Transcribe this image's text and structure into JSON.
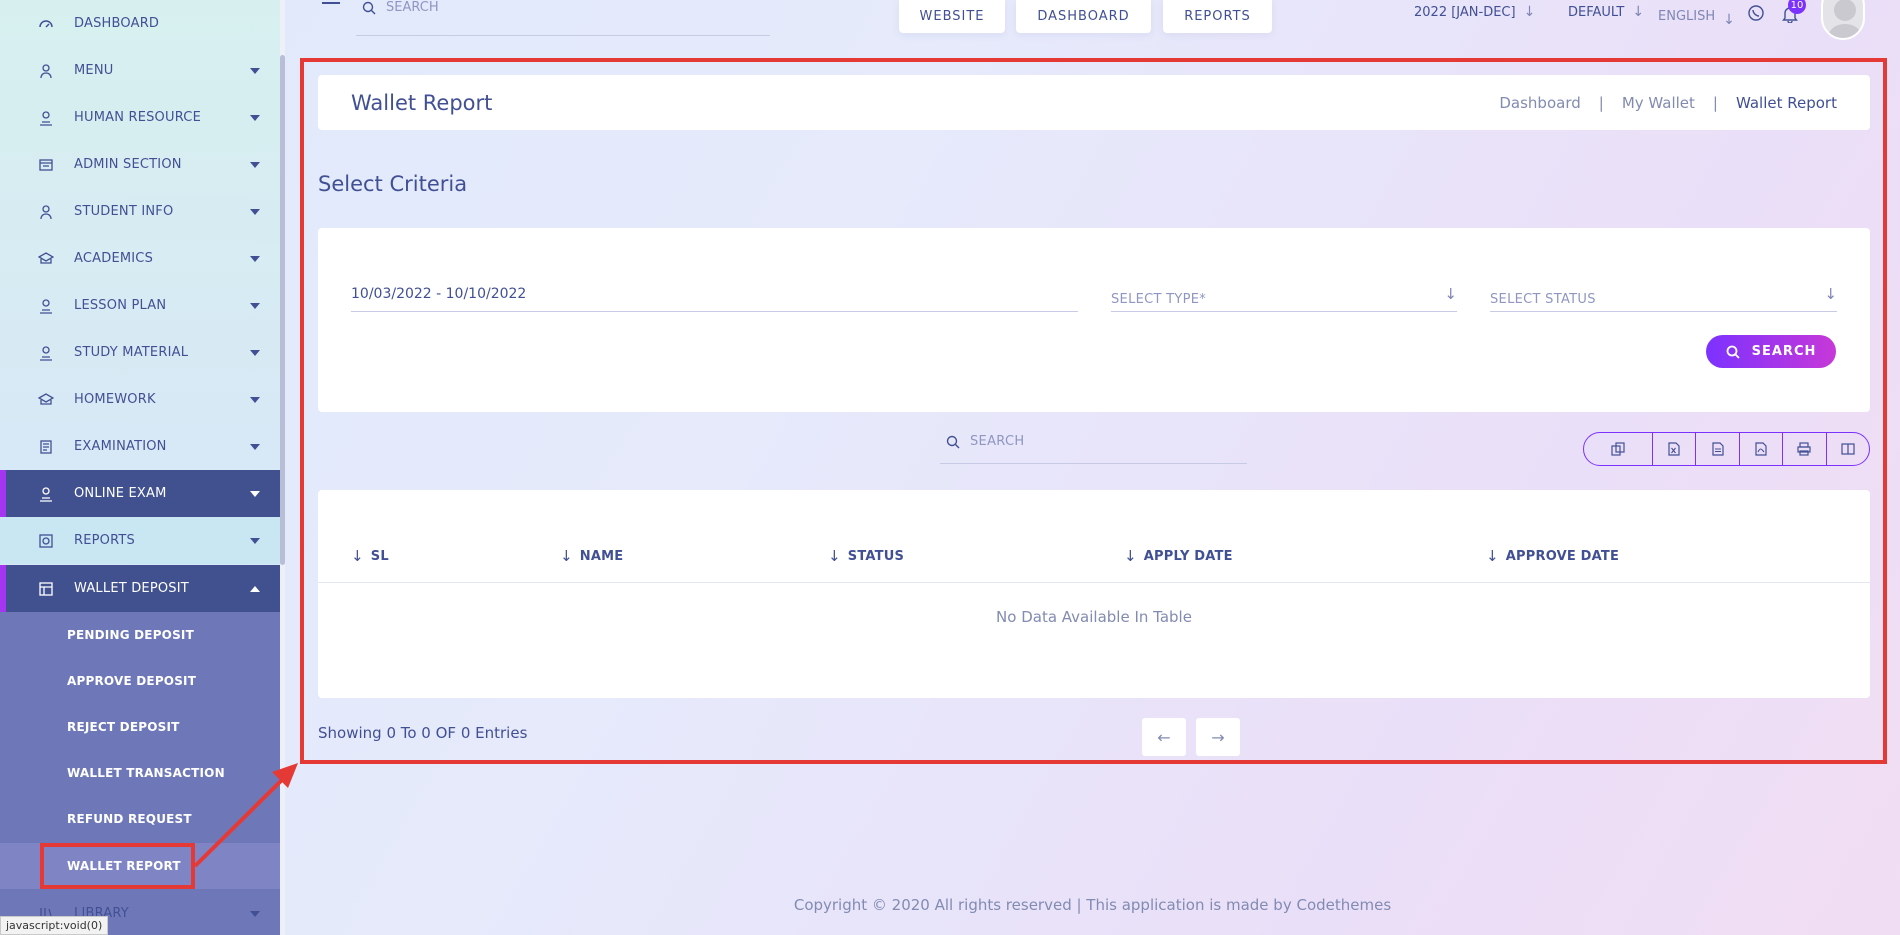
{
  "sidebar": {
    "items": [
      {
        "label": "DASHBOARD",
        "icon": "dashboard-icon"
      },
      {
        "label": "MENU",
        "icon": "menu-icon"
      },
      {
        "label": "HUMAN RESOURCE",
        "icon": "human-resource-icon"
      },
      {
        "label": "ADMIN SECTION",
        "icon": "admin-icon"
      },
      {
        "label": "STUDENT INFO",
        "icon": "student-icon"
      },
      {
        "label": "ACADEMICS",
        "icon": "academics-icon"
      },
      {
        "label": "LESSON PLAN",
        "icon": "lesson-icon"
      },
      {
        "label": "STUDY MATERIAL",
        "icon": "study-icon"
      },
      {
        "label": "HOMEWORK",
        "icon": "homework-icon"
      },
      {
        "label": "EXAMINATION",
        "icon": "examination-icon"
      },
      {
        "label": "ONLINE EXAM",
        "icon": "online-exam-icon"
      },
      {
        "label": "REPORTS",
        "icon": "reports-icon"
      },
      {
        "label": "WALLET DEPOSIT",
        "icon": "wallet-icon"
      },
      {
        "label": "LIBRARY",
        "icon": "library-icon"
      }
    ],
    "wallet_submenu": [
      "PENDING DEPOSIT",
      "APPROVE DEPOSIT",
      "REJECT DEPOSIT",
      "WALLET TRANSACTION",
      "REFUND REQUEST",
      "WALLET REPORT"
    ],
    "status_tip": "javascript:void(0)"
  },
  "topbar": {
    "search_placeholder": "SEARCH",
    "buttons": [
      "WEBSITE",
      "DASHBOARD",
      "REPORTS"
    ],
    "session": "2022 [JAN-DEC]",
    "theme": "DEFAULT",
    "language": "ENGLISH",
    "notification_count": "10"
  },
  "page": {
    "title": "Wallet Report",
    "breadcrumb": [
      "Dashboard",
      "My Wallet",
      "Wallet Report"
    ],
    "breadcrumb_sep": "|"
  },
  "criteria": {
    "heading": "Select Criteria",
    "date_range": "10/03/2022 - 10/10/2022",
    "type_placeholder": "SELECT TYPE*",
    "status_placeholder": "SELECT STATUS",
    "search_label": "SEARCH"
  },
  "table": {
    "search_placeholder": "SEARCH",
    "columns": [
      "SL",
      "NAME",
      "STATUS",
      "APPLY DATE",
      "APPROVE DATE"
    ],
    "empty_message": "No Data Available In Table",
    "info": "Showing 0 To 0 OF 0 Entries",
    "export_icons": [
      "copy-icon",
      "excel-icon",
      "csv-icon",
      "pdf-icon",
      "print-icon",
      "columns-icon"
    ]
  },
  "footer": {
    "text": "Copyright © 2020 All rights reserved | This application is made by Codethemes"
  },
  "colors": {
    "primary": "#415094",
    "accent": "#7c32ff",
    "accent2": "#c738d8",
    "highlight": "#e53935"
  }
}
